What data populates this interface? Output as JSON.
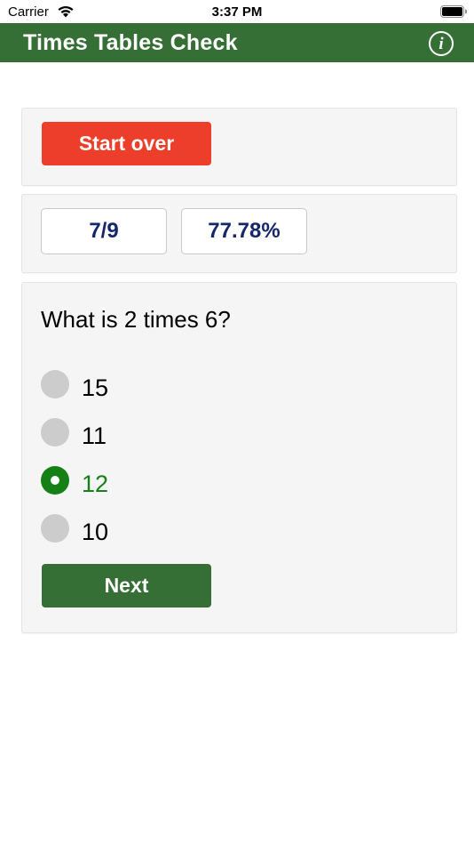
{
  "status_bar": {
    "carrier": "Carrier",
    "time": "3:37 PM"
  },
  "nav": {
    "title": "Times Tables Check",
    "info_icon": "info-icon",
    "info_glyph": "i"
  },
  "controls": {
    "start_over_label": "Start over"
  },
  "score": {
    "count": "7/9",
    "percent": "77.78%"
  },
  "question": {
    "text": "What is 2 times 6?",
    "options": [
      {
        "label": "15",
        "selected": false
      },
      {
        "label": "11",
        "selected": false
      },
      {
        "label": "12",
        "selected": true
      },
      {
        "label": "10",
        "selected": false
      }
    ],
    "next_label": "Next"
  },
  "colors": {
    "nav_green": "#356f35",
    "start_red": "#ec3e2a",
    "selected_green": "#148016",
    "score_navy": "#15276b"
  }
}
